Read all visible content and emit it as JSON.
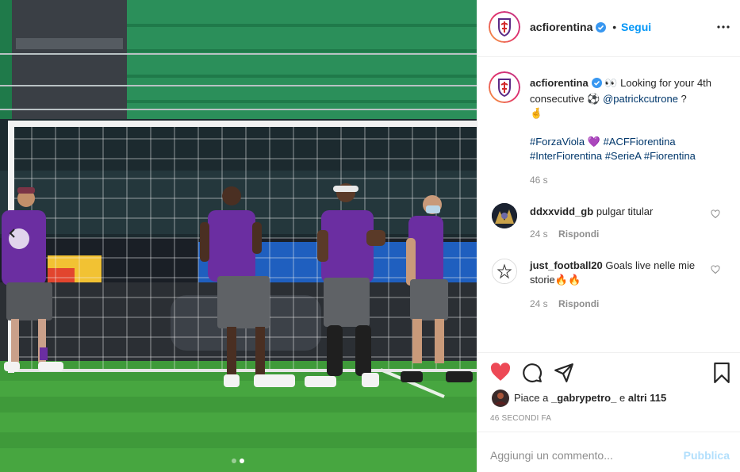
{
  "post": {
    "username": "acfiorentina",
    "follow_label": "Segui",
    "separator": "•",
    "more_icon": "more-horizontal-icon"
  },
  "caption": {
    "username": "acfiorentina",
    "text_eyes": "👀 Looking for your 4th consecutive ⚽",
    "mention": "@patrickcutrone",
    "tail": " ?",
    "hand": "🤞",
    "hashtag1": "#ForzaViola",
    "heart": "💜",
    "hashtag2": "#ACFFiorentina",
    "hashtag3": "#InterFiorentina",
    "hashtag4": "#SerieA",
    "hashtag5": "#Fiorentina",
    "time": "46 s"
  },
  "comments": [
    {
      "username": "ddxxvidd_gb",
      "text": "pulgar titular",
      "time": "24 s",
      "reply": "Rispondi"
    },
    {
      "username": "just_football20",
      "text": "Goals live nelle mie storie🔥🔥",
      "time": "24 s",
      "reply": "Rispondi"
    }
  ],
  "likes": {
    "prefix": "Piace a ",
    "user": "_gabrypetro_",
    "middle": " e ",
    "others": "altri 115"
  },
  "timestamp": "46 SECONDI FA",
  "add_comment": {
    "placeholder": "Aggiungi un commento...",
    "post_label": "Pubblica"
  },
  "carousel": {
    "current": 2,
    "total": 2
  },
  "colors": {
    "accent": "#0095f6",
    "like_red": "#ed4956",
    "fiorentina_purple": "#5b2a86"
  }
}
